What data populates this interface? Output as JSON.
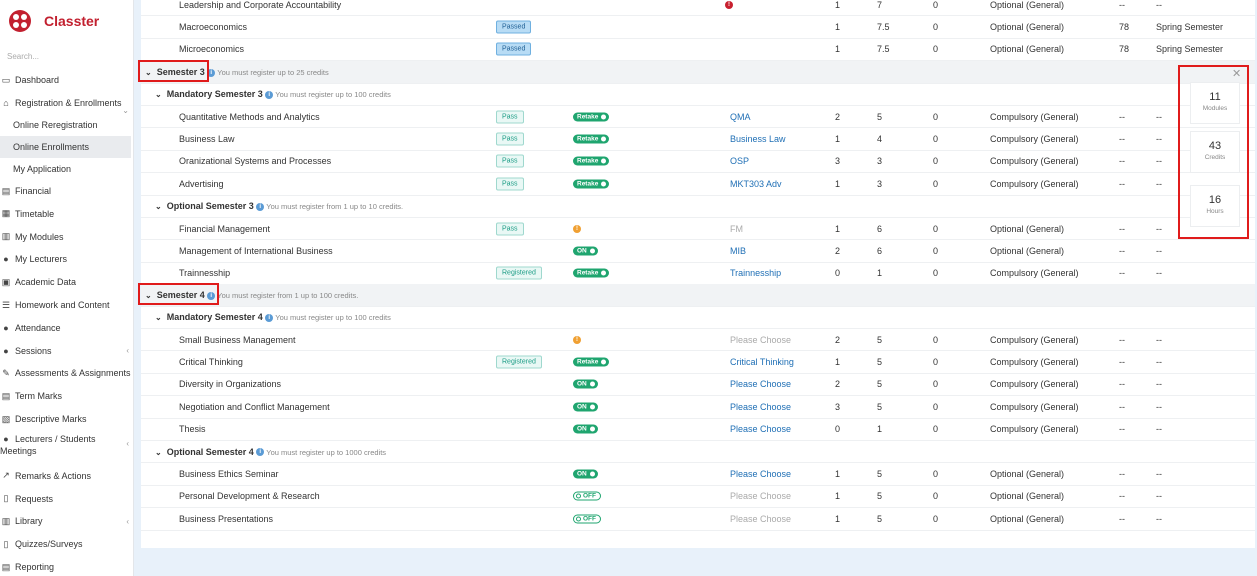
{
  "app": {
    "name": "Classter"
  },
  "search_placeholder": "Search...",
  "nav": {
    "dashboard": "Dashboard",
    "registration": "Registration & Enrollments",
    "online_reregistration": "Online Reregistration",
    "online_enrollments": "Online Enrollments",
    "my_application": "My Application",
    "financial": "Financial",
    "timetable": "Timetable",
    "my_modules": "My Modules",
    "my_lecturers": "My Lecturers",
    "academic_data": "Academic Data",
    "homework": "Homework and Content",
    "attendance": "Attendance",
    "sessions": "Sessions",
    "assessments": "Assessments & Assignments",
    "term_marks": "Term Marks",
    "descriptive_marks": "Descriptive Marks",
    "meetings": "Lecturers / Students Meetings",
    "remarks": "Remarks & Actions",
    "requests": "Requests",
    "library": "Library",
    "quizzes": "Quizzes/Surveys",
    "reporting": "Reporting"
  },
  "top_rows": [
    {
      "name": "Leadership and Corporate Accountability",
      "a": "1",
      "b": "7",
      "c": "0",
      "type": "Optional (General)",
      "grade": "--",
      "semester": "--"
    },
    {
      "name": "Macroeconomics",
      "status": "Passed",
      "a": "1",
      "b": "7.5",
      "c": "0",
      "type": "Optional (General)",
      "grade": "78",
      "semester": "Spring Semester"
    },
    {
      "name": "Microeconomics",
      "status": "Passed",
      "a": "1",
      "b": "7.5",
      "c": "0",
      "type": "Optional (General)",
      "grade": "78",
      "semester": "Spring Semester"
    }
  ],
  "semester3": {
    "title": "Semester 3",
    "hint": "You must register up to 25 credits",
    "mandatory": {
      "title": "Mandatory Semester 3",
      "hint": "You must register up to 100 credits",
      "rows": [
        {
          "name": "Quantitative Methods and Analytics",
          "status": "Pass",
          "toggle": "Retake",
          "code": "QMA",
          "a": "2",
          "b": "5",
          "c": "0",
          "type": "Compulsory (General)",
          "grade": "--",
          "semester": "--"
        },
        {
          "name": "Business Law",
          "status": "Pass",
          "toggle": "Retake",
          "code": "Business Law",
          "a": "1",
          "b": "4",
          "c": "0",
          "type": "Compulsory (General)",
          "grade": "--",
          "semester": "--"
        },
        {
          "name": "Oranizational Systems and Processes",
          "status": "Pass",
          "toggle": "Retake",
          "code": "OSP",
          "a": "3",
          "b": "3",
          "c": "0",
          "type": "Compulsory (General)",
          "grade": "--",
          "semester": "--"
        },
        {
          "name": "Advertising",
          "status": "Pass",
          "toggle": "Retake",
          "code": "MKT303 Adv",
          "a": "1",
          "b": "3",
          "c": "0",
          "type": "Compulsory (General)",
          "grade": "--",
          "semester": "--"
        }
      ]
    },
    "optional": {
      "title": "Optional Semester 3",
      "hint": "You must register from 1 up to 10 credits.",
      "rows": [
        {
          "name": "Financial Management",
          "status": "Pass",
          "code": "FM",
          "a": "1",
          "b": "6",
          "c": "0",
          "type": "Optional (General)",
          "grade": "--",
          "semester": "--"
        },
        {
          "name": "Management of International Business",
          "toggle": "ON",
          "code": "MIB",
          "a": "2",
          "b": "6",
          "c": "0",
          "type": "Optional (General)",
          "grade": "--",
          "semester": "--"
        },
        {
          "name": "Trainnesship",
          "status": "Registered",
          "toggle": "Retake",
          "code": "Trainnesship",
          "a": "0",
          "b": "1",
          "c": "0",
          "type": "Compulsory (General)",
          "grade": "--",
          "semester": "--"
        }
      ]
    }
  },
  "semester4": {
    "title": "Semester 4",
    "hint": "You must register from 1 up to 100 credits.",
    "mandatory": {
      "title": "Mandatory Semester 4",
      "hint": "You must register up to 100 credits",
      "rows": [
        {
          "name": "Small Business Management",
          "code": "Please Choose",
          "a": "2",
          "b": "5",
          "c": "0",
          "type": "Compulsory (General)",
          "grade": "--",
          "semester": "--"
        },
        {
          "name": "Critical Thinking",
          "status": "Registered",
          "toggle": "Retake",
          "code": "Critical Thinking",
          "a": "1",
          "b": "5",
          "c": "0",
          "type": "Compulsory (General)",
          "grade": "--",
          "semester": "--"
        },
        {
          "name": "Diversity in Organizations",
          "toggle": "ON",
          "code": "Please Choose",
          "a": "2",
          "b": "5",
          "c": "0",
          "type": "Compulsory (General)",
          "grade": "--",
          "semester": "--"
        },
        {
          "name": "Negotiation and Conflict Management",
          "toggle": "ON",
          "code": "Please Choose",
          "a": "3",
          "b": "5",
          "c": "0",
          "type": "Compulsory (General)",
          "grade": "--",
          "semester": "--"
        },
        {
          "name": "Thesis",
          "toggle": "ON",
          "code": "Please Choose",
          "a": "0",
          "b": "1",
          "c": "0",
          "type": "Compulsory (General)",
          "grade": "--",
          "semester": "--"
        }
      ]
    },
    "optional": {
      "title": "Optional Semester 4",
      "hint": "You must register up to 1000 credits",
      "rows": [
        {
          "name": "Business Ethics Seminar",
          "toggle": "ON",
          "code": "Please Choose",
          "a": "1",
          "b": "5",
          "c": "0",
          "type": "Optional (General)",
          "grade": "--",
          "semester": "--"
        },
        {
          "name": "Personal Development & Research",
          "toggle": "OFF",
          "code": "Please Choose",
          "a": "1",
          "b": "5",
          "c": "0",
          "type": "Optional (General)",
          "grade": "--",
          "semester": "--"
        },
        {
          "name": "Business Presentations",
          "toggle": "OFF",
          "code": "Please Choose",
          "a": "1",
          "b": "5",
          "c": "0",
          "type": "Optional (General)",
          "grade": "--",
          "semester": "--"
        }
      ]
    }
  },
  "summary": {
    "modules_value": "11",
    "modules_label": "Modules",
    "credits_value": "43",
    "credits_label": "Credits",
    "hours_value": "16",
    "hours_label": "Hours"
  },
  "colors": {
    "brand": "#c2202f",
    "toggle_green": "#1fa56f",
    "link": "#1f6fb5",
    "highlight": "#e01b1b"
  }
}
